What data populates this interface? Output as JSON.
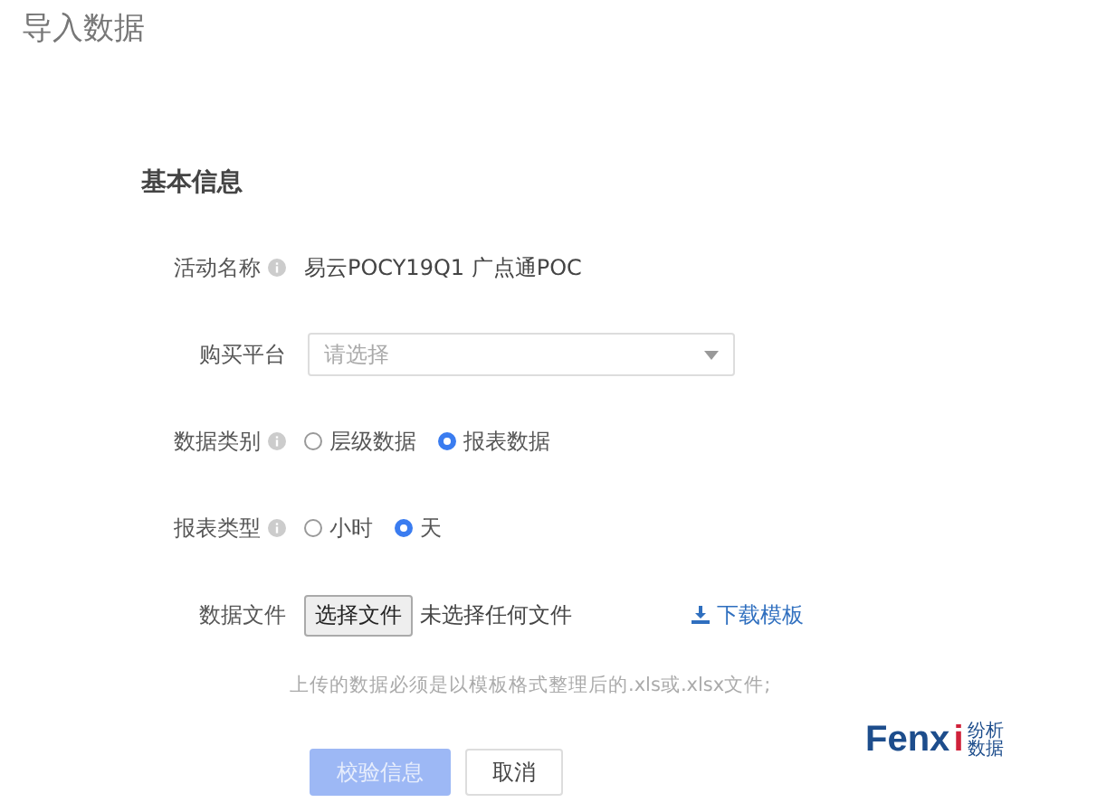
{
  "page_title": "导入数据",
  "section_title": "基本信息",
  "rows": [
    {
      "kind": "text",
      "label": "活动名称",
      "info": true,
      "value": "易云POCY19Q1 广点通POC"
    },
    {
      "kind": "select",
      "label": "购买平台",
      "info": false,
      "placeholder": "请选择"
    },
    {
      "kind": "radio",
      "label": "数据类别",
      "info": true,
      "options": [
        {
          "label": "层级数据",
          "selected": false
        },
        {
          "label": "报表数据",
          "selected": true
        }
      ]
    },
    {
      "kind": "radio",
      "label": "报表类型",
      "info": true,
      "options": [
        {
          "label": "小时",
          "selected": false
        },
        {
          "label": "天",
          "selected": true
        }
      ]
    },
    {
      "kind": "file",
      "label": "数据文件",
      "info": false,
      "button": "选择文件",
      "status": "未选择任何文件",
      "link": "下载模板"
    }
  ],
  "hint": "上传的数据必须是以模板格式整理后的.xls或.xlsx文件;",
  "buttons": [
    {
      "label": "校验信息",
      "kind": "primary",
      "disabled": true
    },
    {
      "label": "取消",
      "kind": "default",
      "disabled": false
    }
  ],
  "logo": {
    "word": "Fenx",
    "accent": "i",
    "sub_top": "纷析",
    "sub_bottom": "数据"
  }
}
